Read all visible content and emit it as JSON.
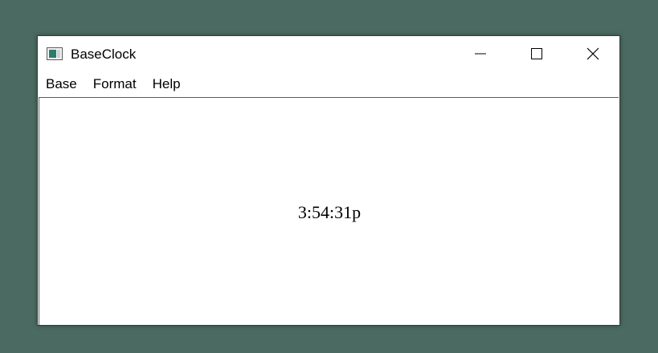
{
  "window": {
    "title": "BaseClock",
    "icon": "app-window-icon",
    "controls": {
      "minimize_icon": "minimize-icon",
      "maximize_icon": "maximize-icon",
      "close_icon": "close-icon"
    }
  },
  "menu": {
    "items": [
      {
        "label": "Base"
      },
      {
        "label": "Format"
      },
      {
        "label": "Help"
      }
    ]
  },
  "clock": {
    "time": "3:54:31p"
  },
  "colors": {
    "desktop": "#4b6b62",
    "window_bg": "#ffffff",
    "text": "#000000",
    "icon_accent": "#2d7a6e"
  }
}
